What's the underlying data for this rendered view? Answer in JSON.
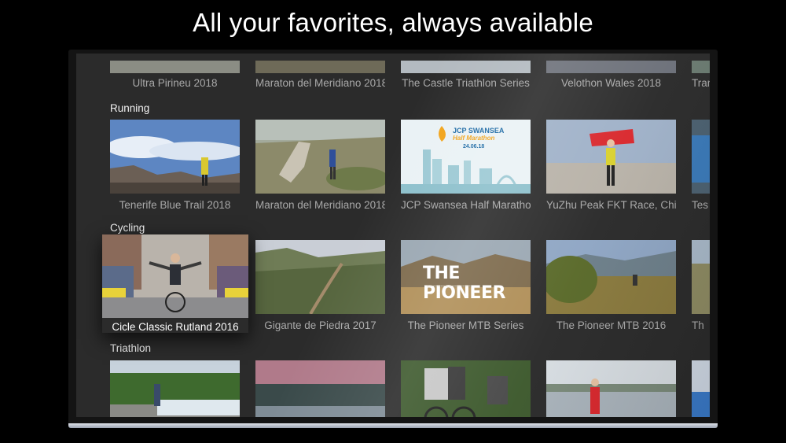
{
  "headline": "All your favorites, always available",
  "rows": {
    "top": {
      "items": [
        "Ultra Pirineu 2018",
        "Maraton del Meridiano 2018",
        "The Castle Triathlon Series",
        "Velothon Wales 2018",
        "Tran"
      ]
    },
    "running": {
      "title": "Running",
      "items": [
        "Tenerife Blue Trail 2018",
        "Maraton del Meridiano 2018",
        "JCP Swansea Half Marathon",
        "YuZhu Peak FKT Race, China",
        "Tes"
      ]
    },
    "cycling": {
      "title": "Cycling",
      "items": [
        "Cicle Classic Rutland 2016",
        "Gigante de Piedra 2017",
        "The Pioneer MTB Series",
        "The Pioneer MTB 2016",
        "Th"
      ]
    },
    "triathlon": {
      "title": "Triathlon"
    }
  },
  "posters": {
    "swansea_brand": "JCP SWANSEA",
    "swansea_sub": "Half Marathon",
    "swansea_date": "24.06.18",
    "pioneer_logo": "THE PIONEER"
  },
  "focused_item": "Cicle Classic Rutland 2016"
}
